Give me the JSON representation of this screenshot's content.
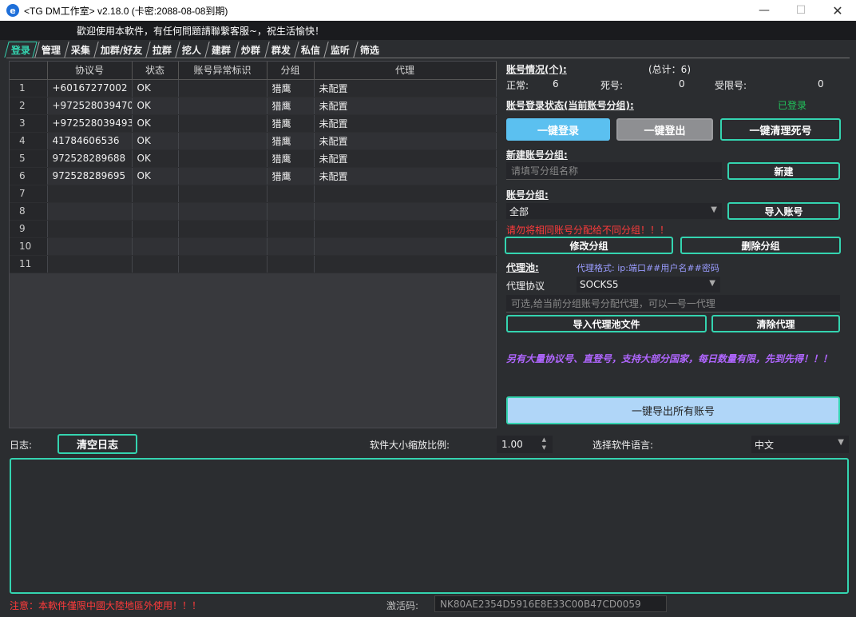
{
  "window": {
    "icon_letter": "e",
    "title": "<TG DM工作室> v2.18.0 (卡密:2088-08-08到期)",
    "min_glyph": "—",
    "max_glyph": "☐",
    "close_glyph": "✕"
  },
  "welcome": "歡迎使用本軟件，有任何問題請聯繫客服~，祝生活愉快！",
  "tabs": [
    "登录",
    "管理",
    "采集",
    "加群/好友",
    "拉群",
    "挖人",
    "建群",
    "炒群",
    "群发",
    "私信",
    "监听",
    "筛选"
  ],
  "table": {
    "columns": [
      "",
      "协议号",
      "状态",
      "账号异常标识",
      "分组",
      "代理"
    ],
    "rows": [
      {
        "n": "1",
        "phone": "+60167277002",
        "status": "OK",
        "flag": "",
        "group": "猎鹰",
        "proxy": "未配置"
      },
      {
        "n": "2",
        "phone": "+972528039470",
        "status": "OK",
        "flag": "",
        "group": "猎鹰",
        "proxy": "未配置"
      },
      {
        "n": "3",
        "phone": "+972528039493",
        "status": "OK",
        "flag": "",
        "group": "猎鹰",
        "proxy": "未配置"
      },
      {
        "n": "4",
        "phone": "41784606536",
        "status": "OK",
        "flag": "",
        "group": "猎鹰",
        "proxy": "未配置"
      },
      {
        "n": "5",
        "phone": "972528289688",
        "status": "OK",
        "flag": "",
        "group": "猎鹰",
        "proxy": "未配置"
      },
      {
        "n": "6",
        "phone": "972528289695",
        "status": "OK",
        "flag": "",
        "group": "猎鹰",
        "proxy": "未配置"
      },
      {
        "n": "7",
        "phone": "",
        "status": "",
        "flag": "",
        "group": "",
        "proxy": ""
      },
      {
        "n": "8",
        "phone": "",
        "status": "",
        "flag": "",
        "group": "",
        "proxy": ""
      },
      {
        "n": "9",
        "phone": "",
        "status": "",
        "flag": "",
        "group": "",
        "proxy": ""
      },
      {
        "n": "10",
        "phone": "",
        "status": "",
        "flag": "",
        "group": "",
        "proxy": ""
      },
      {
        "n": "11",
        "phone": "",
        "status": "",
        "flag": "",
        "group": "",
        "proxy": ""
      }
    ]
  },
  "account": {
    "header": "账号情况(个):",
    "total": "(总计：6)",
    "normal_label": "正常:",
    "normal": "6",
    "dead_label": "死号:",
    "dead": "0",
    "limited_label": "受限号:",
    "limited": "0",
    "login_state_header": "账号登录状态(当前账号分组):",
    "login_state": "已登录",
    "login_btn": "一键登录",
    "logout_btn": "一键登出",
    "clean_btn": "一键清理死号"
  },
  "new_group": {
    "header": "新建账号分组:",
    "placeholder": "请填写分组名称",
    "create_btn": "新建"
  },
  "group": {
    "header": "账号分组:",
    "selected": "全部",
    "import_btn": "导入账号",
    "warning": "请勿将相同账号分配给不同分组！！！",
    "edit_btn": "修改分组",
    "delete_btn": "删除分组"
  },
  "proxy": {
    "header": "代理池:",
    "format_hint": "代理格式: ip:端口##用户名##密码",
    "protocol_label": "代理协议",
    "protocol": "SOCKS5",
    "placeholder": "可选,给当前分组账号分配代理，可以一号一代理",
    "import_btn": "导入代理池文件",
    "clear_btn": "清除代理"
  },
  "promo": "另有大量协议号、直登号，支持大部分国家，每日数量有限，先到先得！！！",
  "export_btn": "一键导出所有账号",
  "log": {
    "label": "日志:",
    "clear_btn": "清空日志",
    "scale_label": "软件大小缩放比例:",
    "scale": "1.00",
    "lang_label": "选择软件语言:",
    "lang": "中文"
  },
  "footer": {
    "notice": "注意：本軟件僅限中國大陸地區外使用！！！",
    "code_label": "激活码:",
    "code": "NK80AE2354D5916E8E33C00B47CD0059"
  }
}
